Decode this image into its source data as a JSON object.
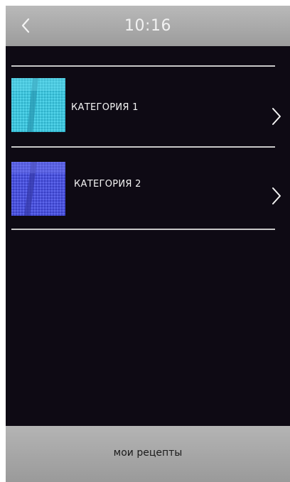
{
  "header": {
    "back_icon": "chevron-left-icon",
    "time": "10:16"
  },
  "categories": [
    {
      "label": "КАТЕГОРИЯ 1",
      "thumb_color": "#3fc4dc",
      "chevron_icon": "chevron-right-icon"
    },
    {
      "label": "КАТЕГОРИЯ 2",
      "thumb_color": "#4a52dc",
      "chevron_icon": "chevron-right-icon"
    }
  ],
  "footer": {
    "label": "мои рецепты"
  },
  "colors": {
    "background": "#0e0a14",
    "bars": "#a8a8a8"
  }
}
